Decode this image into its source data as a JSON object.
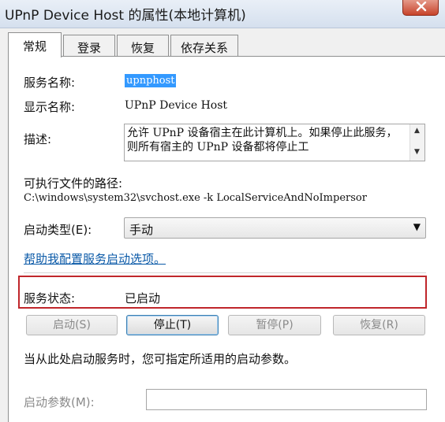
{
  "window": {
    "title": "UPnP Device Host 的属性(本地计算机)"
  },
  "tabs": [
    {
      "label": "常规",
      "active": true
    },
    {
      "label": "登录",
      "active": false
    },
    {
      "label": "恢复",
      "active": false
    },
    {
      "label": "依存关系",
      "active": false
    }
  ],
  "general": {
    "service_name_label": "服务名称:",
    "service_name_value": "upnphost",
    "display_name_label": "显示名称:",
    "display_name_value": "UPnP Device Host",
    "description_label": "描述:",
    "description_text": "允许 UPnP 设备宿主在此计算机上。如果停止此服务，则所有宿主的 UPnP 设备都将停止工",
    "exe_path_label": "可执行文件的路径:",
    "exe_path_value": "C:\\windows\\system32\\svchost.exe -k LocalServiceAndNoImpersor",
    "startup_type_label": "启动类型(E):",
    "startup_type_value": "手动",
    "help_link": "帮助我配置服务启动选项。",
    "status_label": "服务状态:",
    "status_value": "已启动",
    "buttons": {
      "start": "启动(S)",
      "stop": "停止(T)",
      "pause": "暂停(P)",
      "resume": "恢复(R)"
    },
    "start_params_hint": "当从此处启动服务时，您可指定所适用的启动参数。",
    "start_params_label": "启动参数(M):",
    "start_params_value": ""
  },
  "colors": {
    "highlight_frame": "#c0262b",
    "selection": "#3399ff",
    "link": "#0b5aa8"
  }
}
